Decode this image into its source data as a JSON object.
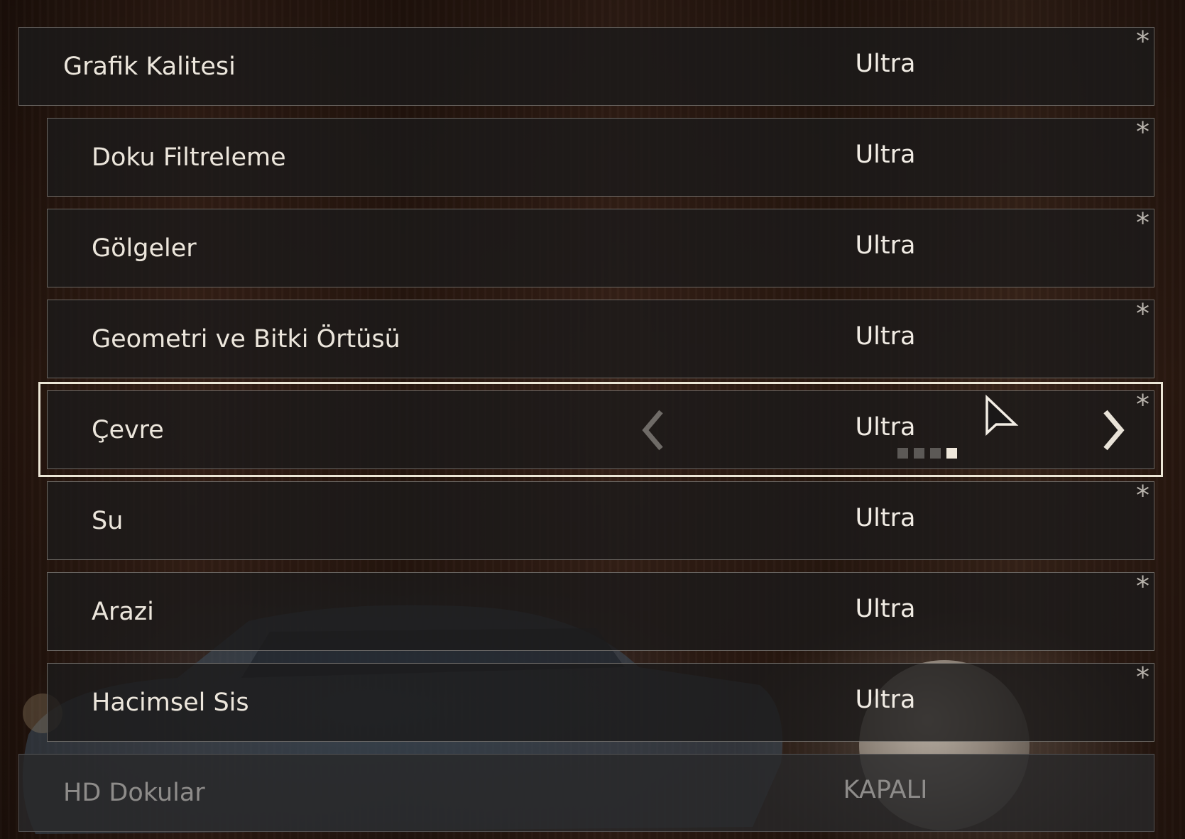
{
  "settings": {
    "master": {
      "label": "Grafik Kalitesi",
      "value": "Ultra",
      "marker": "*"
    },
    "items": [
      {
        "label": "Doku Filtreleme",
        "value": "Ultra",
        "marker": "*"
      },
      {
        "label": "Gölgeler",
        "value": "Ultra",
        "marker": "*"
      },
      {
        "label": "Geometri ve Bitki Örtüsü",
        "value": "Ultra",
        "marker": "*"
      },
      {
        "label": "Çevre",
        "value": "Ultra",
        "marker": "*"
      },
      {
        "label": "Su",
        "value": "Ultra",
        "marker": "*"
      },
      {
        "label": "Arazi",
        "value": "Ultra",
        "marker": "*"
      },
      {
        "label": "Hacimsel Sis",
        "value": "Ultra",
        "marker": "*"
      }
    ],
    "hd_textures": {
      "label": "HD Dokular",
      "value": "KAPALI"
    }
  },
  "selected": {
    "index": 4,
    "level_index": 4,
    "level_count": 4,
    "icons": [
      "chevron-left-icon",
      "chevron-right-icon"
    ]
  },
  "colors": {
    "text": "#ece6dc",
    "disabled_text": "#8e8c8a",
    "focus_border": "#ece6d6",
    "row_background": "#1c1a1a"
  }
}
